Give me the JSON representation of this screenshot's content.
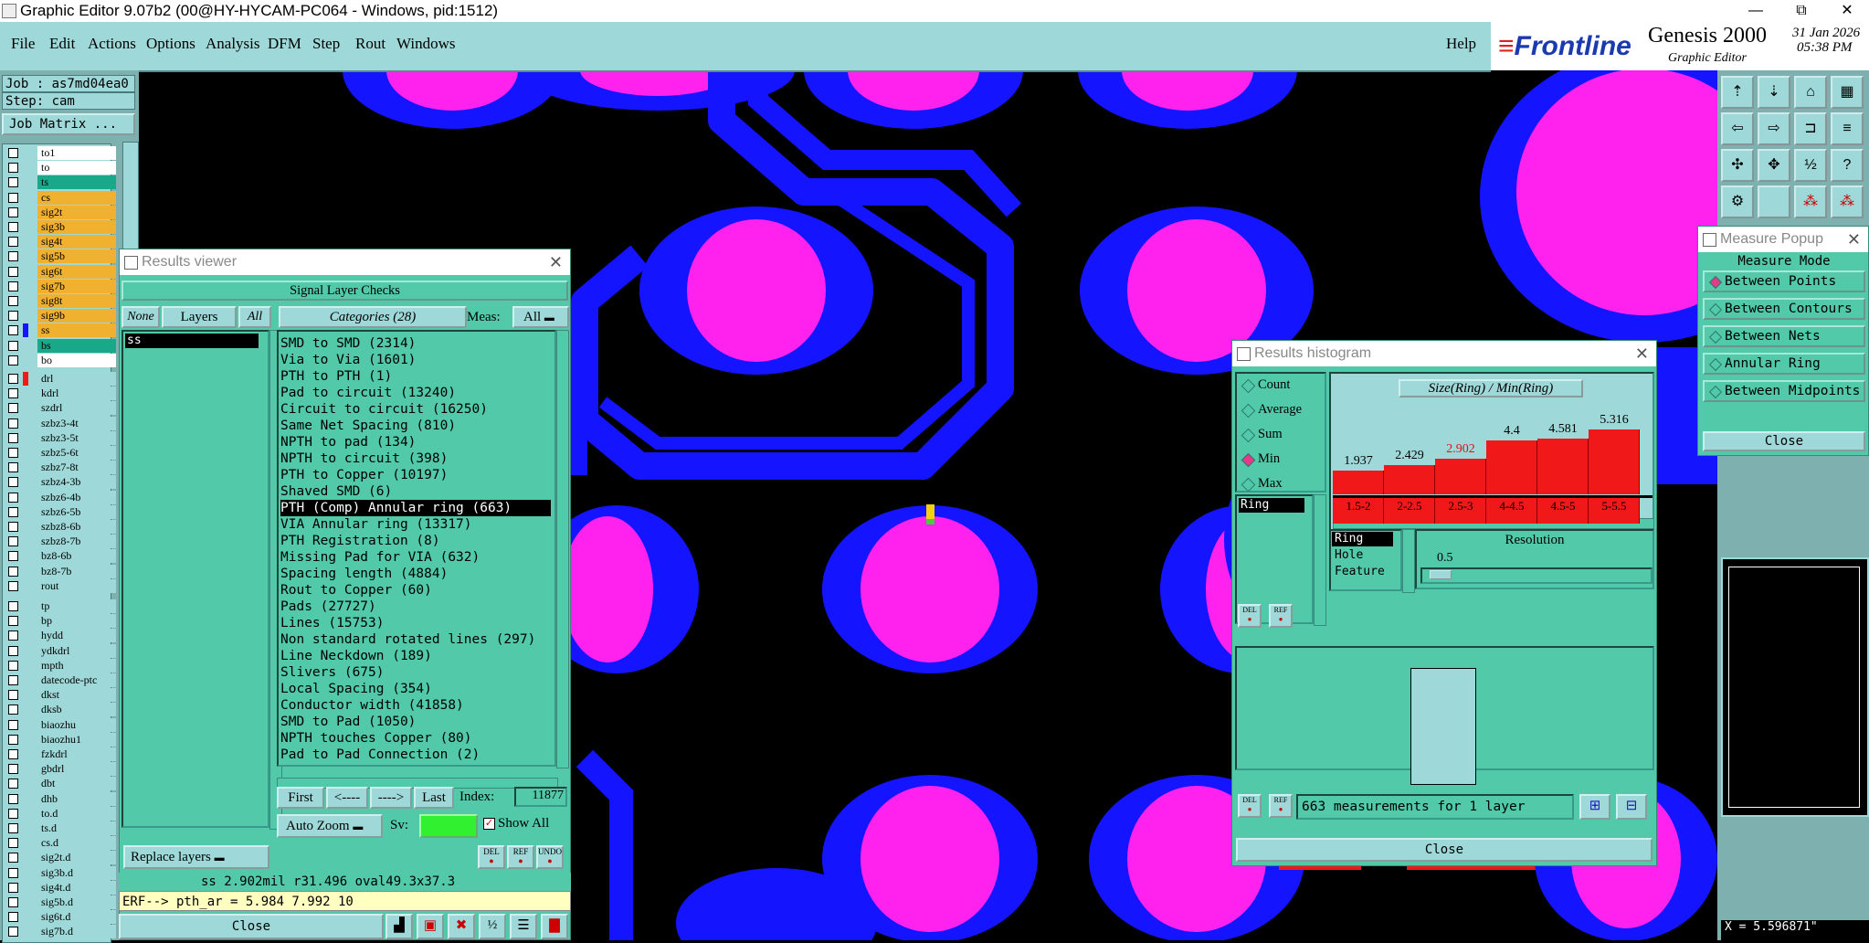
{
  "window": {
    "title": "Graphic Editor 9.07b2 (00@HY-HYCAM-PC064 - Windows, pid:1512)",
    "min": "—",
    "restore": "⧉",
    "close": "✕"
  },
  "menu": [
    "File",
    "Edit",
    "Actions",
    "Options",
    "Analysis",
    "DFM",
    "Step",
    "Rout",
    "Windows"
  ],
  "help": "Help",
  "brand": {
    "logo": "Frontline",
    "product": "Genesis 2000",
    "sub": "Graphic Editor",
    "date": "31 Jan 2026",
    "time": "05:38 PM"
  },
  "left": {
    "job": "Job : as7md04ea0",
    "step": "Step: cam",
    "job_matrix": "Job Matrix ...",
    "layers_group1": [
      {
        "name": "to1",
        "bg": "#ffffff"
      },
      {
        "name": "to",
        "bg": "#ffffff"
      },
      {
        "name": "ts",
        "bg": "#1aa88a"
      },
      {
        "name": "cs",
        "bg": "#f0b030"
      },
      {
        "name": "sig2t",
        "bg": "#f0b030"
      },
      {
        "name": "sig3b",
        "bg": "#f0b030"
      },
      {
        "name": "sig4t",
        "bg": "#f0b030"
      },
      {
        "name": "sig5b",
        "bg": "#f0b030"
      },
      {
        "name": "sig6t",
        "bg": "#f0b030"
      },
      {
        "name": "sig7b",
        "bg": "#f0b030"
      },
      {
        "name": "sig8t",
        "bg": "#f0b030"
      },
      {
        "name": "sig9b",
        "bg": "#f0b030"
      },
      {
        "name": "ss",
        "bg": "#f0b030",
        "sel": true
      },
      {
        "name": "bs",
        "bg": "#1aa88a"
      },
      {
        "name": "bo",
        "bg": "#ffffff"
      }
    ],
    "layers_group2": [
      "drl",
      "kdrl",
      "szdrl",
      "szbz3-4t",
      "szbz3-5t",
      "szbz5-6t",
      "szbz7-8t",
      "szbz4-3b",
      "szbz6-4b",
      "szbz6-5b",
      "szbz8-6b",
      "szbz8-7b",
      "bz8-6b",
      "bz8-7b",
      "rout"
    ],
    "layers_group3": [
      "tp",
      "bp",
      "hydd",
      "ydkdrl",
      "mpth",
      "datecode-ptc",
      "dkst",
      "dksb",
      "biaozhu",
      "biaozhu1",
      "fzkdrl",
      "gbdrl",
      "dbt",
      "dhb",
      "to.d",
      "ts.d",
      "cs.d",
      "sig2t.d",
      "sig3b.d",
      "sig4t.d",
      "sig5b.d",
      "sig6t.d",
      "sig7b.d"
    ]
  },
  "results_viewer": {
    "title": "Results viewer",
    "header": "Signal Layer Checks",
    "none": "None",
    "layers": "Layers",
    "all": "All",
    "layer_list": [
      "ss"
    ],
    "categories_label": "Categories (28)",
    "meas_label": "Meas:",
    "meas_value": "All",
    "categories": [
      "SMD to SMD (2314)",
      "Via to Via (1601)",
      "PTH to PTH (1)",
      "Pad to circuit (13240)",
      "Circuit to circuit (16250)",
      "Same Net Spacing (810)",
      "NPTH to pad (134)",
      "NPTH to circuit (398)",
      "PTH to Copper (10197)",
      "Shaved SMD (6)",
      "PTH (Comp) Annular ring (663)",
      "VIA Annular ring (13317)",
      "PTH Registration (8)",
      "Missing Pad for VIA (632)",
      "Spacing length (4884)",
      "Rout to Copper (60)",
      "Pads (27727)",
      "Lines (15753)",
      "Non standard rotated lines (297)",
      "Line Neckdown (189)",
      "Slivers (675)",
      "Local Spacing (354)",
      "Conductor width (41858)",
      "SMD to Pad (1050)",
      "NPTH touches Copper (80)",
      "Pad to Pad Connection (2)"
    ],
    "selected_index": 10,
    "first": "First",
    "prev": "<----",
    "next": "---->",
    "last": "Last",
    "index_label": "Index:",
    "index_value": "11877",
    "auto_zoom": "Auto Zoom",
    "sv_label": "Sv:",
    "show_all": "Show All",
    "replace_layers": "Replace layers",
    "del": "DEL",
    "ref": "REF",
    "undo": "UNDO",
    "status1": "ss 2.902mil  r31.496  oval49.3x37.3",
    "status2": "ERF--> pth_ar = 5.984 7.992 10",
    "close": "Close"
  },
  "histogram": {
    "title": "Results histogram",
    "modes": [
      {
        "label": "Count",
        "on": false
      },
      {
        "label": "Average",
        "on": false
      },
      {
        "label": "Sum",
        "on": false
      },
      {
        "label": "Min",
        "on": true
      },
      {
        "label": "Max",
        "on": false
      }
    ],
    "chart_title": "Size(Ring) / Min(Ring)",
    "bins": [
      "1.5-2",
      "2-2.5",
      "2.5-3",
      "4-4.5",
      "4.5-5",
      "5-5.5"
    ],
    "values": [
      "1.937",
      "2.429",
      "2.902",
      "4.4",
      "4.581",
      "5.316"
    ],
    "highlight_index": 2,
    "left_list": [
      "Ring"
    ],
    "res_list": [
      "Ring",
      "Hole",
      "Feature"
    ],
    "resolution_label": "Resolution",
    "resolution_value": "0.5",
    "summary": "663 measurements for 1 layer",
    "del": "DEL",
    "ref": "REF",
    "close": "Close"
  },
  "measure": {
    "title": "Measure Popup",
    "mode_label": "Measure Mode",
    "modes": [
      {
        "label": "Between Points",
        "on": true
      },
      {
        "label": "Between Contours",
        "on": false
      },
      {
        "label": "Between Nets",
        "on": false
      },
      {
        "label": "Annular Ring",
        "on": false
      },
      {
        "label": "Between Midpoints",
        "on": false
      }
    ],
    "close": "Close"
  },
  "coords": {
    "x": "X = 5.596871\""
  },
  "colors": {
    "pad": "#ff22ee",
    "copper": "#1414ff",
    "bg": "#000000",
    "panel": "#52c9a9"
  }
}
